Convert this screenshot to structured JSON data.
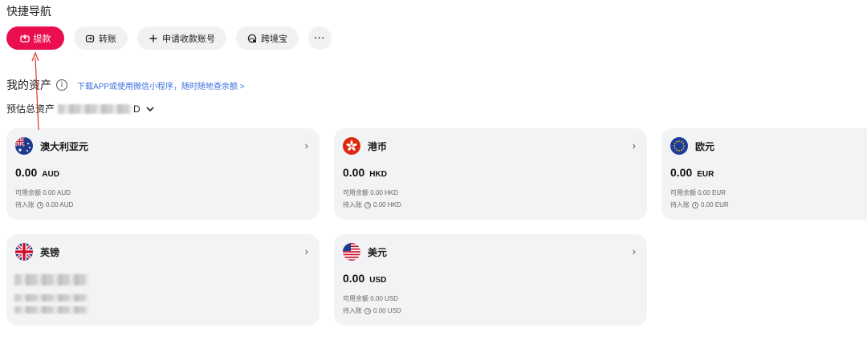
{
  "quick_nav": {
    "title": "快捷导航",
    "buttons": [
      {
        "label": "提款",
        "icon": "withdraw-icon"
      },
      {
        "label": "转账",
        "icon": "transfer-icon"
      },
      {
        "label": "申请收款账号",
        "icon": "plus-icon"
      },
      {
        "label": "跨境宝",
        "icon": "cross-border-icon"
      },
      {
        "label": "···",
        "icon": "more-icon"
      }
    ]
  },
  "assets": {
    "title": "我的资产",
    "download_link": "下载APP或使用微信小程序，随时随地查余额 >",
    "total_label": "预估总资产",
    "total_suffix": "D",
    "cards": [
      {
        "name": "澳大利亚元",
        "amount": "0.00",
        "code": "AUD",
        "available": "可用余额 0.00 AUD",
        "pending_label": "待入账",
        "pending_value": "0.00 AUD",
        "flag": "australia-flag-icon"
      },
      {
        "name": "港币",
        "amount": "0.00",
        "code": "HKD",
        "available": "可用余额 0.00 HKD",
        "pending_label": "待入账",
        "pending_value": "0.00 HKD",
        "flag": "hongkong-flag-icon"
      },
      {
        "name": "欧元",
        "amount": "0.00",
        "code": "EUR",
        "available": "可用余额 0.00 EUR",
        "pending_label": "待入账",
        "pending_value": "0.00 EUR",
        "flag": "eu-flag-icon"
      },
      {
        "name": "英镑",
        "flag": "uk-flag-icon"
      },
      {
        "name": "美元",
        "amount": "0.00",
        "code": "USD",
        "available": "可用余额 0.00 USD",
        "pending_label": "待入账",
        "pending_value": "0.00 USD",
        "flag": "us-flag-icon"
      }
    ]
  },
  "colors": {
    "accent": "#ea0e4f",
    "card_bg": "#f2f3f5",
    "link": "#3b6fe0",
    "annotation": "#e0351e"
  }
}
